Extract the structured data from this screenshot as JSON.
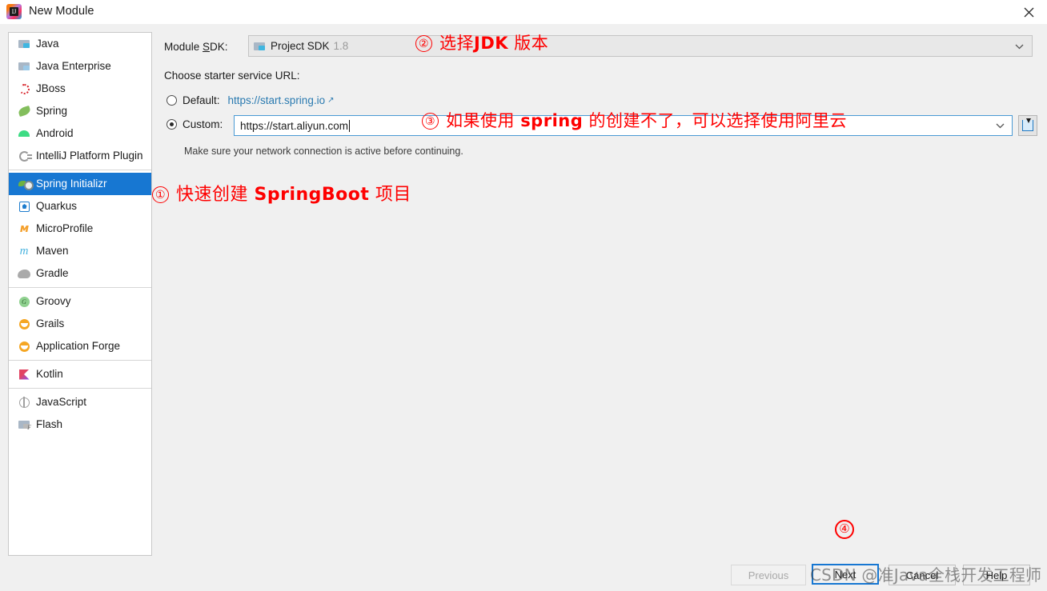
{
  "window": {
    "title": "New Module",
    "app_icon": "intellij-idea-logo",
    "close_icon": "close-icon"
  },
  "sidebar": {
    "groups": [
      {
        "items": [
          {
            "label": "Java",
            "icon": "java-folder-icon",
            "selected": false
          },
          {
            "label": "Java Enterprise",
            "icon": "java-enterprise-icon",
            "selected": false
          },
          {
            "label": "JBoss",
            "icon": "jboss-icon",
            "selected": false
          },
          {
            "label": "Spring",
            "icon": "spring-leaf-icon",
            "selected": false
          },
          {
            "label": "Android",
            "icon": "android-icon",
            "selected": false
          },
          {
            "label": "IntelliJ Platform Plugin",
            "icon": "plugin-icon",
            "selected": false
          }
        ]
      },
      {
        "items": [
          {
            "label": "Spring Initializr",
            "icon": "spring-initializr-icon",
            "selected": true
          },
          {
            "label": "Quarkus",
            "icon": "quarkus-icon",
            "selected": false
          },
          {
            "label": "MicroProfile",
            "icon": "microprofile-icon",
            "selected": false
          },
          {
            "label": "Maven",
            "icon": "maven-icon",
            "selected": false
          },
          {
            "label": "Gradle",
            "icon": "gradle-elephant-icon",
            "selected": false
          }
        ]
      },
      {
        "items": [
          {
            "label": "Groovy",
            "icon": "groovy-icon",
            "selected": false
          },
          {
            "label": "Grails",
            "icon": "grails-icon",
            "selected": false
          },
          {
            "label": "Application Forge",
            "icon": "application-forge-icon",
            "selected": false
          }
        ]
      },
      {
        "items": [
          {
            "label": "Kotlin",
            "icon": "kotlin-icon",
            "selected": false
          }
        ]
      },
      {
        "items": [
          {
            "label": "JavaScript",
            "icon": "javascript-icon",
            "selected": false
          },
          {
            "label": "Flash",
            "icon": "flash-icon",
            "selected": false
          }
        ]
      }
    ]
  },
  "main": {
    "module_sdk_label": "Module SDK:",
    "module_sdk_value": "Project SDK",
    "module_sdk_version": "1.8",
    "choose_url_label": "Choose starter service URL:",
    "default_radio_label": "Default:",
    "default_url": "https://start.spring.io",
    "default_link_icon": "external-link-icon",
    "default_selected": false,
    "custom_radio_label": "Custom:",
    "custom_url_value": "https://start.aliyun.com",
    "custom_selected": true,
    "import_button_icon": "import-settings-icon",
    "hint": "Make sure your network connection is active before continuing."
  },
  "buttons": {
    "previous": "Previous",
    "next": "Next",
    "cancel": "Cancel",
    "help": "Help"
  },
  "annotations": [
    {
      "marker": "①",
      "text_pre": "快速创建 ",
      "text_bold": "SpringBoot",
      "text_post": " 项目"
    },
    {
      "marker": "②",
      "text_pre": "选择",
      "text_bold": "JDK",
      "text_post": " 版本"
    },
    {
      "marker": "③",
      "text_pre": "如果使用 ",
      "text_bold": "spring",
      "text_post": " 的创建不了，可以选择使用阿里云"
    },
    {
      "marker": "④",
      "text_pre": "",
      "text_bold": "",
      "text_post": ""
    }
  ],
  "watermark": "CSDN @准Java全栈开发工程师",
  "colors": {
    "accent": "#1777d2",
    "annotation": "#fe0000",
    "link": "#2a7ab0",
    "dialog_bg": "#f0f0f0"
  }
}
